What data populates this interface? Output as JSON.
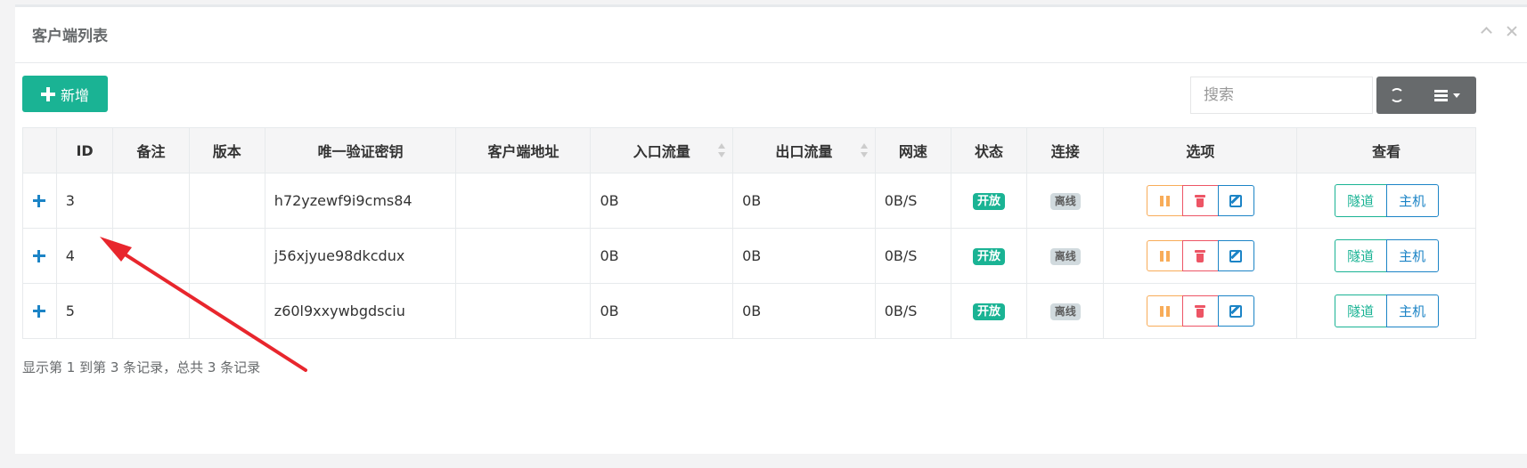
{
  "panel": {
    "title": "客户端列表"
  },
  "toolbar": {
    "add_label": "新增",
    "search_placeholder": "搜索"
  },
  "table": {
    "columns": [
      "",
      "ID",
      "备注",
      "版本",
      "唯一验证密钥",
      "客户端地址",
      "入口流量",
      "出口流量",
      "网速",
      "状态",
      "连接",
      "选项",
      "查看"
    ],
    "rows": [
      {
        "id": "3",
        "remark": "",
        "version": "",
        "key": "h72yzewf9i9cms84",
        "address": "",
        "in_flow": "0B",
        "out_flow": "0B",
        "speed": "0B/S",
        "status": "开放",
        "conn": "离线"
      },
      {
        "id": "4",
        "remark": "",
        "version": "",
        "key": "j56xjyue98dkcdux",
        "address": "",
        "in_flow": "0B",
        "out_flow": "0B",
        "speed": "0B/S",
        "status": "开放",
        "conn": "离线"
      },
      {
        "id": "5",
        "remark": "",
        "version": "",
        "key": "z60l9xxywbgdsciu",
        "address": "",
        "in_flow": "0B",
        "out_flow": "0B",
        "speed": "0B/S",
        "status": "开放",
        "conn": "离线"
      }
    ],
    "view_tunnel_label": "隧道",
    "view_host_label": "主机"
  },
  "footer": {
    "summary": "显示第 1 到第 3 条记录，总共 3 条记录"
  },
  "colors": {
    "primary": "#1ab394",
    "info": "#1c84c6",
    "warning": "#f8ac59",
    "danger": "#ed5565",
    "annotation_arrow": "#e8262d"
  },
  "icons": [
    "chevron-up-icon",
    "close-icon",
    "plus-icon",
    "refresh-icon",
    "columns-list-icon",
    "pause-icon",
    "trash-icon",
    "edit-icon"
  ]
}
